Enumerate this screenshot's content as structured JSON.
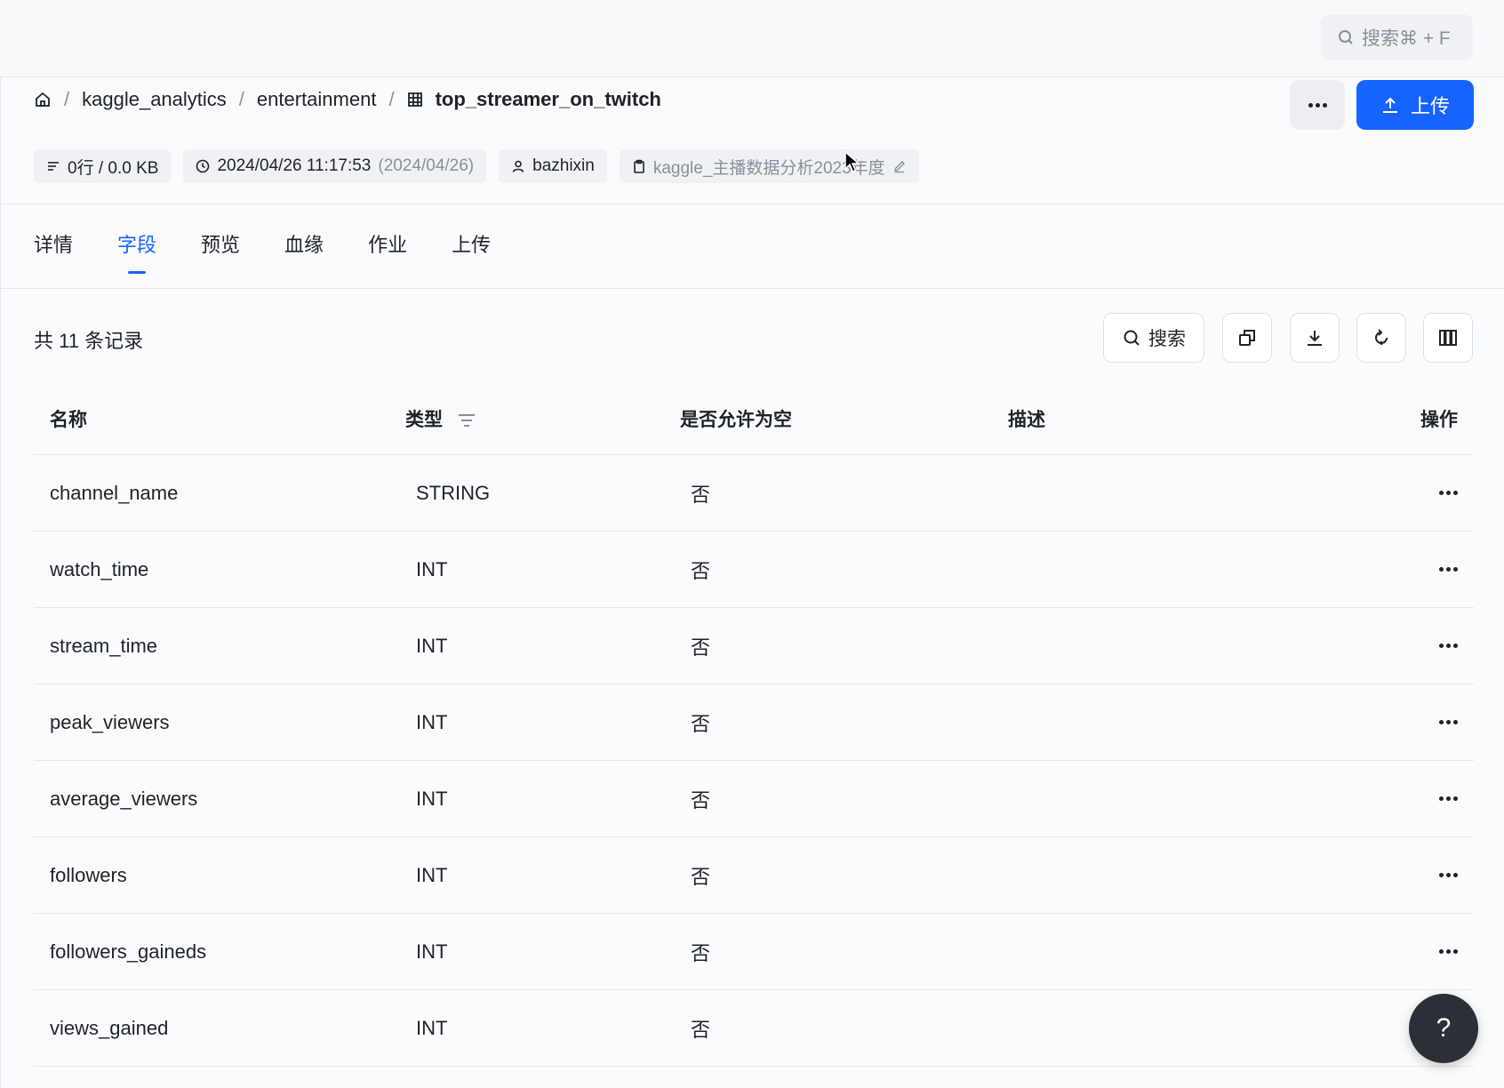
{
  "global_search": {
    "label": "搜索⌘ + F"
  },
  "breadcrumb": {
    "items": [
      "kaggle_analytics",
      "entertainment"
    ],
    "current": "top_streamer_on_twitch",
    "separator": "/"
  },
  "actions": {
    "upload_label": "上传"
  },
  "meta": {
    "rows_size": "0行 / 0.0 KB",
    "timestamp": "2024/04/26 11:17:53",
    "date_short": "(2024/04/26)",
    "owner": "bazhixin",
    "description": "kaggle_主播数据分析2023年度"
  },
  "tabs": [
    {
      "label": "详情",
      "active": false
    },
    {
      "label": "字段",
      "active": true
    },
    {
      "label": "预览",
      "active": false
    },
    {
      "label": "血缘",
      "active": false
    },
    {
      "label": "作业",
      "active": false
    },
    {
      "label": "上传",
      "active": false
    }
  ],
  "toolbar": {
    "record_count": "共 11 条记录",
    "search_label": "搜索"
  },
  "table": {
    "headers": {
      "name": "名称",
      "type": "类型",
      "nullable": "是否允许为空",
      "desc": "描述",
      "ops": "操作"
    },
    "rows": [
      {
        "name": "channel_name",
        "type": "STRING",
        "nullable": "否",
        "desc": ""
      },
      {
        "name": "watch_time",
        "type": "INT",
        "nullable": "否",
        "desc": ""
      },
      {
        "name": "stream_time",
        "type": "INT",
        "nullable": "否",
        "desc": ""
      },
      {
        "name": "peak_viewers",
        "type": "INT",
        "nullable": "否",
        "desc": ""
      },
      {
        "name": "average_viewers",
        "type": "INT",
        "nullable": "否",
        "desc": ""
      },
      {
        "name": "followers",
        "type": "INT",
        "nullable": "否",
        "desc": ""
      },
      {
        "name": "followers_gaineds",
        "type": "INT",
        "nullable": "否",
        "desc": ""
      },
      {
        "name": "views_gained",
        "type": "INT",
        "nullable": "否",
        "desc": ""
      }
    ]
  },
  "help": {
    "label": "?"
  },
  "colors": {
    "accent": "#1664ff",
    "text": "#1f2329",
    "muted": "#8a8f99",
    "border": "#e5e6eb"
  },
  "icons": [
    "search-icon",
    "home-icon",
    "table-icon",
    "more-icon",
    "upload-icon",
    "rows-icon",
    "clock-icon",
    "user-icon",
    "clipboard-icon",
    "edit-icon",
    "copy-icon",
    "download-icon",
    "refresh-icon",
    "columns-icon",
    "filter-icon"
  ]
}
